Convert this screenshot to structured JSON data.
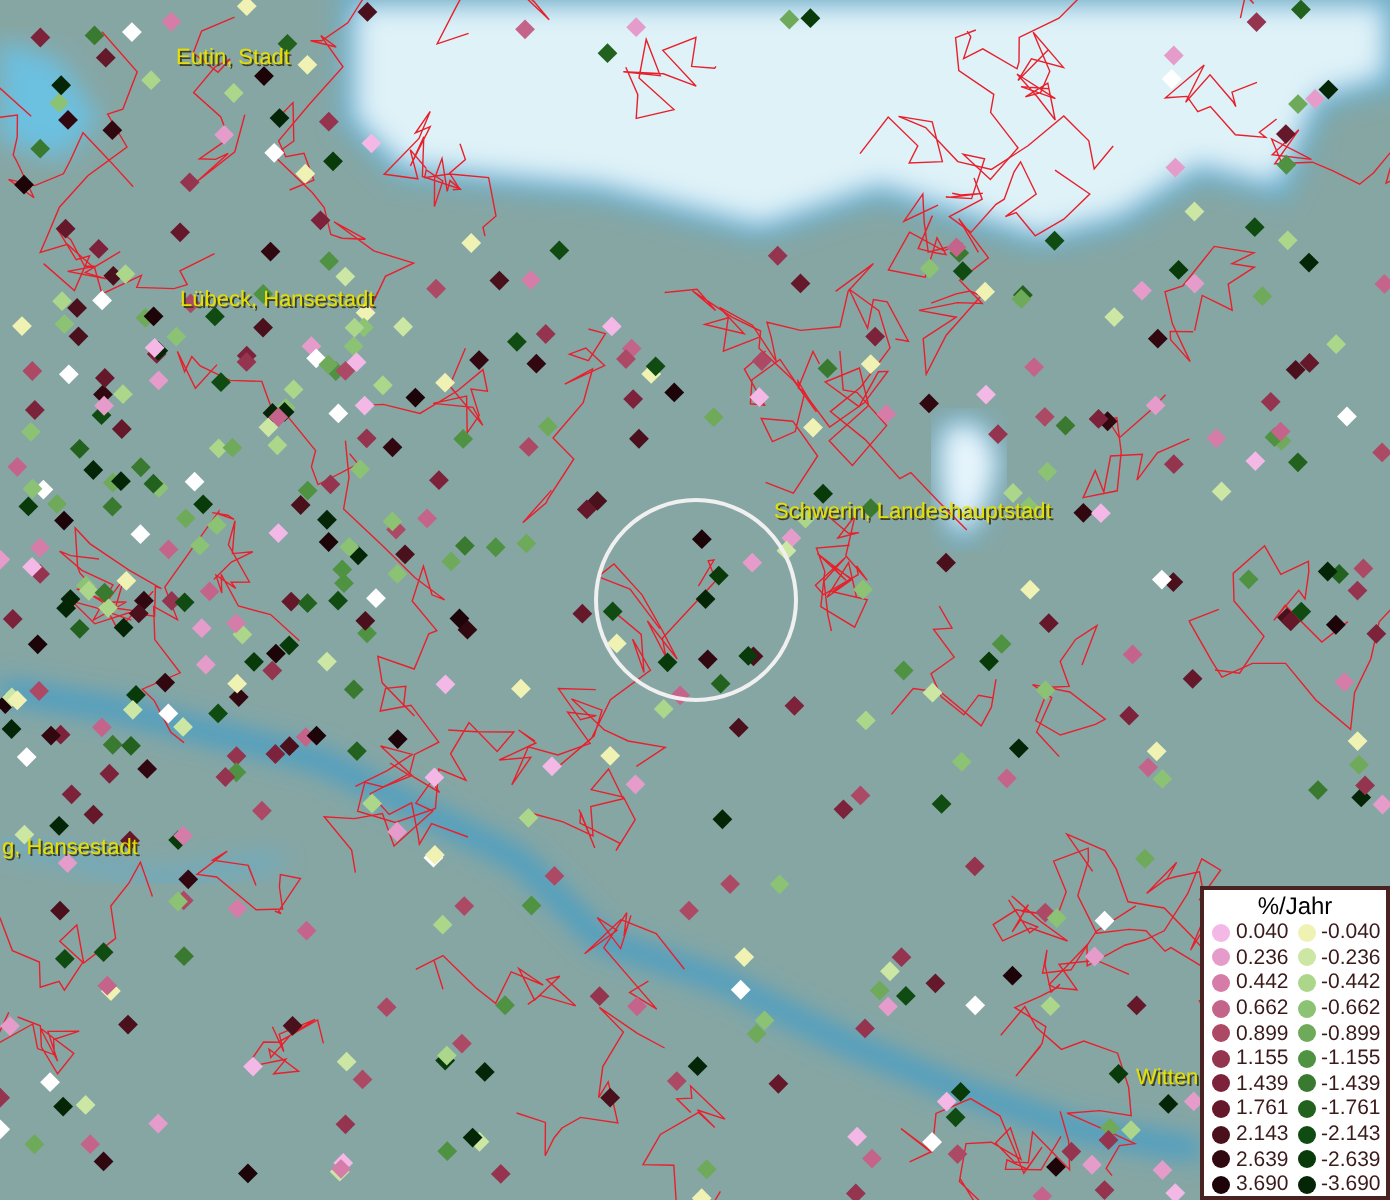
{
  "map": {
    "place_labels": [
      {
        "text": "Eutin, Stadt",
        "kind": "city"
      },
      {
        "text": "Lübeck, Hansestadt",
        "kind": "city"
      },
      {
        "text": "g, Hansestadt",
        "kind": "city"
      },
      {
        "text": "Schwerin, Landeshauptstadt",
        "kind": "city"
      },
      {
        "text": "Witten",
        "kind": "city"
      }
    ]
  },
  "legend": {
    "title": "%/Jahr",
    "items": [
      {
        "label": "0.040",
        "color": "#f4b8e6"
      },
      {
        "label": "-0.040",
        "color": "#f0f2b4"
      },
      {
        "label": "0.236",
        "color": "#e69cca"
      },
      {
        "label": "-0.236",
        "color": "#cce6a4"
      },
      {
        "label": "0.442",
        "color": "#d67ca8"
      },
      {
        "label": "-0.442",
        "color": "#acd68a"
      },
      {
        "label": "0.662",
        "color": "#c4648a"
      },
      {
        "label": "-0.662",
        "color": "#8cc274"
      },
      {
        "label": "0.899",
        "color": "#ac4a66"
      },
      {
        "label": "-0.899",
        "color": "#6eaa5a"
      },
      {
        "label": "1.155",
        "color": "#94344e"
      },
      {
        "label": "-1.155",
        "color": "#4e9242"
      },
      {
        "label": "1.439",
        "color": "#7c223a"
      },
      {
        "label": "-1.439",
        "color": "#3a7a30"
      },
      {
        "label": "1.761",
        "color": "#64182a"
      },
      {
        "label": "-1.761",
        "color": "#22621e"
      },
      {
        "label": "2.143",
        "color": "#4a101c"
      },
      {
        "label": "-2.143",
        "color": "#104c12"
      },
      {
        "label": "2.639",
        "color": "#320810"
      },
      {
        "label": "-2.639",
        "color": "#083a0a"
      },
      {
        "label": "3.690",
        "color": "#1c0408"
      },
      {
        "label": "-3.690",
        "color": "#042606"
      }
    ]
  }
}
